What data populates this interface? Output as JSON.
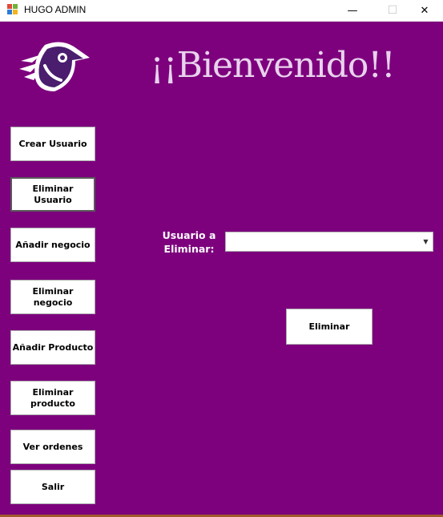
{
  "window": {
    "title": "HUGO ADMIN",
    "minimize_glyph": "—",
    "maximize_glyph": "☐",
    "close_glyph": "✕",
    "icon": "windows-forms-app-icon"
  },
  "header": {
    "logo_icon": "bird-logo-icon",
    "welcome_text": "¡¡Bienvenido!!"
  },
  "sidebar": {
    "items": [
      {
        "label": "Crear Usuario"
      },
      {
        "label": "Eliminar Usuario"
      },
      {
        "label": "Añadir negocio"
      },
      {
        "label": "Eliminar\nnegocio"
      },
      {
        "label": "Añadir Producto"
      },
      {
        "label": "Eliminar\nproducto"
      },
      {
        "label": "Ver ordenes"
      },
      {
        "label": "Salir"
      }
    ]
  },
  "form": {
    "label": "Usuario a Eliminar:",
    "combo_value": "",
    "combo_arrow_icon": "chevron-down-icon",
    "action_label": "Eliminar"
  },
  "colors": {
    "background": "#7d007d",
    "welcome_text": "#e8d2ec",
    "logo_body": "#4a1d6e",
    "button_bg": "#ffffff"
  }
}
